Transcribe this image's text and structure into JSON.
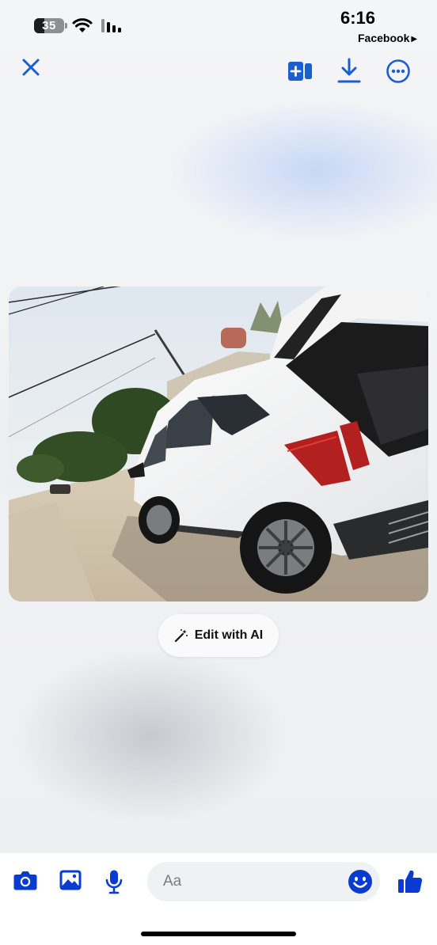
{
  "status_bar": {
    "battery_level": "35",
    "battery_fraction": 0.35,
    "time": "6:16",
    "back_app": "Facebook",
    "back_arrow": "▶"
  },
  "toolbar": {
    "icons": [
      "close-icon",
      "add-to-story-icon",
      "download-icon",
      "more-icon"
    ],
    "accent_color": "#1a5fd0"
  },
  "photo": {
    "subject": "photo"
  },
  "edit_ai": {
    "label": "Edit with AI",
    "icon": "magic-wand-icon"
  },
  "composer": {
    "icons": [
      "camera-icon",
      "gallery-icon",
      "microphone-icon",
      "emoji-icon",
      "thumbs-up-icon"
    ],
    "placeholder": "Aa",
    "accent_color": "#0a3bd1"
  }
}
